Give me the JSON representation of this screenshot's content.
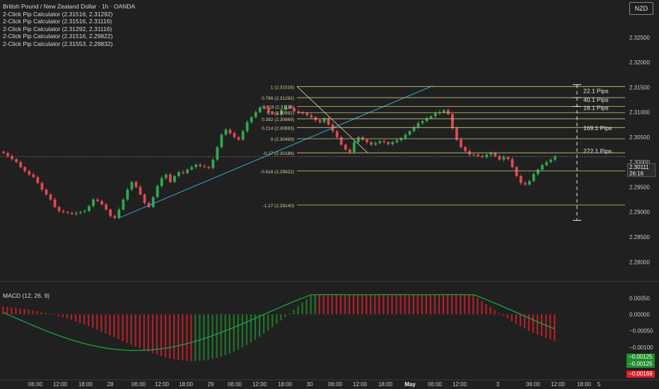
{
  "header": {
    "title": "British Pound / New Zealand Dollar · 1h · OANDA",
    "indicators": [
      "2-Click Pip Calculator (2.31516, 2.31292)",
      "2-Click Pip Calculator (2.31516, 2.31116)",
      "2-Click Pip Calculator (2.31292, 2.31116)",
      "2-Click Pip Calculator (2.31516, 2.29822)",
      "2-Click Pip Calculator (2.31553, 2.28832)"
    ],
    "currency": "NZD"
  },
  "price_tag": {
    "price": "2.30111",
    "countdown": "26:16"
  },
  "macd": {
    "label": "MACD (12, 26, 9)",
    "tags": [
      "−0.00125",
      "−0.00125",
      "−0.00169"
    ]
  },
  "colors": {
    "up": "#2fa84f",
    "down": "#e04a52",
    "fib": "#c9c97a",
    "trend": "#3aa6c8",
    "macd_line_up": "#1f8f2e",
    "macd_line_down": "#e0202a"
  },
  "chart_data": [
    {
      "type": "candlestick",
      "instrument": "GBPNZD",
      "timeframe": "1h",
      "y_axis": {
        "ticks": [
          "2.33000",
          "2.32500",
          "2.32000",
          "2.31500",
          "2.31000",
          "2.30500",
          "2.30000",
          "2.29500",
          "2.29000",
          "2.28500",
          "2.28000"
        ],
        "ylim": [
          2.2772,
          2.3325
        ]
      },
      "x_axis": {
        "ticks": [
          "06:00",
          "12:00",
          "18:00",
          "28",
          "06:00",
          "12:00",
          "18:00",
          "29",
          "06:00",
          "12:00",
          "18:00",
          "30",
          "06:00",
          "12:00",
          "18:00",
          "May",
          "06:00",
          "12:00",
          "3",
          "06:00",
          "12:00",
          "18:00",
          "5"
        ],
        "bold": [
          "May"
        ]
      },
      "current_price": 2.30111,
      "series_close": [
        2.3018,
        2.3012,
        2.3006,
        2.3,
        2.299,
        2.2982,
        2.2975,
        2.297,
        2.2958,
        2.2945,
        2.2935,
        2.2925,
        2.291,
        2.2902,
        2.29,
        2.2898,
        2.2896,
        2.2898,
        2.29,
        2.2902,
        2.2912,
        2.2925,
        2.2922,
        2.2915,
        2.2905,
        2.2892,
        2.2888,
        2.2905,
        2.2925,
        2.2945,
        2.296,
        2.295,
        2.2935,
        2.2918,
        2.291,
        2.293,
        2.2952,
        2.2968,
        2.2975,
        2.296,
        2.2972,
        2.298,
        2.2978,
        2.2985,
        2.299,
        2.2995,
        2.2992,
        2.299,
        2.2988,
        2.3005,
        2.303,
        2.3055,
        2.3065,
        2.3058,
        2.305,
        2.3045,
        2.3062,
        2.308,
        2.309,
        2.31,
        2.311,
        2.3108,
        2.31,
        2.3098,
        2.3095,
        2.3105,
        2.3112,
        2.3108,
        2.3102,
        2.31,
        2.3098,
        2.3094,
        2.309,
        2.3084,
        2.308,
        2.3088,
        2.3075,
        2.3062,
        2.305,
        2.3035,
        2.3025,
        2.302,
        2.304,
        2.305,
        2.3045,
        2.304,
        2.3035,
        2.3038,
        2.3042,
        2.304,
        2.3036,
        2.304,
        2.3044,
        2.3048,
        2.3055,
        2.3062,
        2.307,
        2.3078,
        2.3082,
        2.3088,
        2.3092,
        2.3098,
        2.31,
        2.3104,
        2.3096,
        2.3068,
        2.3045,
        2.303,
        2.3022,
        2.3015,
        2.3015,
        2.3012,
        2.301,
        2.3015,
        2.3018,
        2.3012,
        2.3005,
        2.301,
        2.3006,
        2.299,
        2.2972,
        2.2958,
        2.2955,
        2.2962,
        2.2976,
        2.2985,
        2.2994,
        2.3,
        2.3005,
        2.3011
      ],
      "fibonacci": [
        {
          "label": "1 (2.31516)",
          "price": 2.31516
        },
        {
          "label": "0.786 (2.31292)",
          "price": 2.31292
        },
        {
          "label": "0.618 (2.31116)",
          "price": 2.31116
        },
        {
          "label": "0.5 (2.30992)",
          "price": 2.30992
        },
        {
          "label": "0.382 (2.30869)",
          "price": 2.30869
        },
        {
          "label": "0.214 (2.30693)",
          "price": 2.30693
        },
        {
          "label": "0 (2.30469)",
          "price": 2.30469
        },
        {
          "label": "-0.27 (2.30186)",
          "price": 2.30186
        },
        {
          "label": "-0.618 (2.29822)",
          "price": 2.29822
        },
        {
          "label": "-1.27 (2.29140)",
          "price": 2.2914
        }
      ],
      "pip_labels": [
        "22.1 Pips",
        "40.1 Pips",
        "18.1 Pips",
        "169.1 Pips",
        "272.1 Pips"
      ],
      "pip_label_prices": [
        2.3143,
        2.3125,
        2.3109,
        2.3068,
        2.3022
      ]
    },
    {
      "type": "bar",
      "name": "MACD (12, 26, 9)",
      "y_axis": {
        "ticks": [
          "0.00050",
          "0.00000",
          "−0.00050",
          "−0.00100",
          "−0.00150"
        ],
        "ylim": [
          -0.00195,
          0.00085
        ]
      }
    }
  ]
}
